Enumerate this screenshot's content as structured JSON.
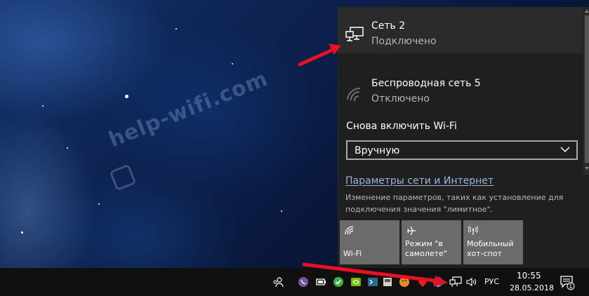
{
  "watermark": {
    "text": "help-wifi.com"
  },
  "flyout": {
    "networks": [
      {
        "name": "Сеть 2",
        "status": "Подключено",
        "icon": "ethernet-icon"
      },
      {
        "name": "Беспроводная сеть 5",
        "status": "Отключено",
        "icon": "wifi-disabled-icon"
      }
    ],
    "wifi_on_label": "Снова включить Wi-Fi",
    "wifi_on_value": "Вручную",
    "settings_link": "Параметры сети и Интернет",
    "settings_desc": "Изменение параметров, таких как установление для подключения значения \"лимитное\".",
    "tiles": [
      {
        "label": "Wi-Fi",
        "icon": "wifi-icon"
      },
      {
        "label": "Режим \"в самолете\"",
        "icon": "airplane-icon"
      },
      {
        "label": "Мобильный хот-спот",
        "icon": "hotspot-icon"
      }
    ]
  },
  "taskbar": {
    "language": "РУС",
    "time": "10:55",
    "date": "28.05.2018",
    "notification_count": "1"
  },
  "colors": {
    "flyout_bg": "#1f1f1f",
    "active_item_bg": "#2a2a2a",
    "tile_bg": "#6b6b6b",
    "link": "#9ab5d8",
    "arrow": "#e81123"
  }
}
